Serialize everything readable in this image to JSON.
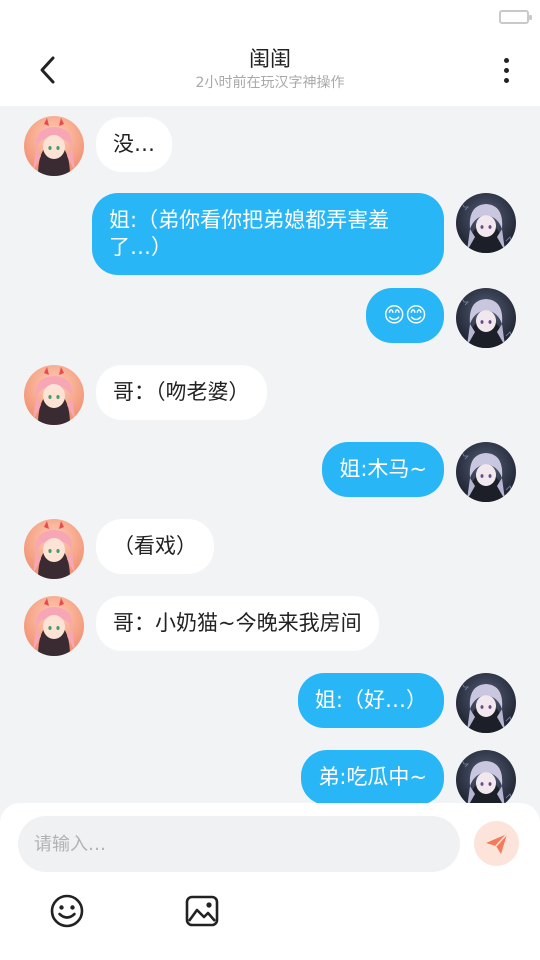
{
  "header": {
    "title": "闺闺",
    "subtitle": "2小时前在玩汉字神操作"
  },
  "messages": [
    {
      "side": "left",
      "text": "没…"
    },
    {
      "side": "right",
      "text": "姐:（弟你看你把弟媳都弄害羞了…）"
    },
    {
      "side": "right",
      "text": "😊😊"
    },
    {
      "side": "left",
      "text": "哥：（吻老婆）"
    },
    {
      "side": "right",
      "text": "姐:木马~"
    },
    {
      "side": "left",
      "text": "（看戏）"
    },
    {
      "side": "left",
      "text": "哥：小奶猫~今晚来我房间"
    },
    {
      "side": "right",
      "text": "姐:（好…）"
    },
    {
      "side": "right",
      "text": "弟:吃瓜中~"
    }
  ],
  "input": {
    "placeholder": "请输入…",
    "value": ""
  },
  "icons": {
    "back": "chevron-left-icon",
    "more": "more-vertical-icon",
    "send": "send-icon",
    "emoji": "emoji-icon",
    "image": "image-icon",
    "battery": "battery-icon"
  },
  "colors": {
    "own_bubble": "#29b6f6",
    "other_bubble": "#ffffff",
    "background": "#f2f3f5",
    "send_button": "#fde4da",
    "send_icon": "#f47a5a"
  }
}
